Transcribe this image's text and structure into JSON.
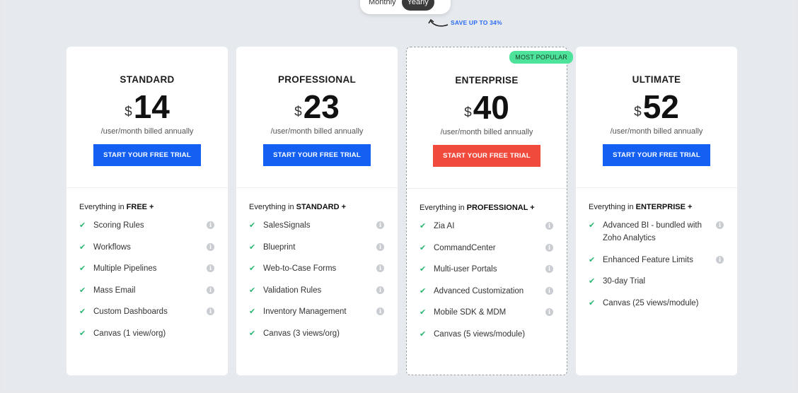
{
  "billing_toggle": {
    "options": [
      "Monthly",
      "Yearly"
    ],
    "selected": "Yearly"
  },
  "save_note": "SAVE UP TO 34%",
  "colors": {
    "primary_cta": "#1460f2",
    "featured_cta": "#ef4a3c",
    "badge": "#4ee39a",
    "check": "#2bb673"
  },
  "plans": [
    {
      "name": "STANDARD",
      "currency": "$",
      "price": "14",
      "period": "/user/month billed annually",
      "cta": "START YOUR FREE TRIAL",
      "everything_prefix": "Everything in ",
      "everything_plan": "FREE +",
      "features": [
        {
          "label": "Scoring Rules",
          "info": true
        },
        {
          "label": "Workflows",
          "info": true
        },
        {
          "label": "Multiple Pipelines",
          "info": true
        },
        {
          "label": "Mass Email",
          "info": true
        },
        {
          "label": "Custom Dashboards",
          "info": true
        },
        {
          "label": "Canvas (1 view/org)",
          "info": false
        }
      ]
    },
    {
      "name": "PROFESSIONAL",
      "currency": "$",
      "price": "23",
      "period": "/user/month billed annually",
      "cta": "START YOUR FREE TRIAL",
      "everything_prefix": "Everything in ",
      "everything_plan": "STANDARD +",
      "features": [
        {
          "label": "SalesSignals",
          "info": true
        },
        {
          "label": "Blueprint",
          "info": true
        },
        {
          "label": "Web-to-Case Forms",
          "info": true
        },
        {
          "label": "Validation Rules",
          "info": true
        },
        {
          "label": "Inventory Management",
          "info": true
        },
        {
          "label": "Canvas (3 views/org)",
          "info": false
        }
      ]
    },
    {
      "name": "ENTERPRISE",
      "badge": "MOST POPULAR",
      "currency": "$",
      "price": "40",
      "period": "/user/month billed annually",
      "cta": "START YOUR FREE TRIAL",
      "everything_prefix": "Everything in ",
      "everything_plan": "PROFESSIONAL +",
      "features": [
        {
          "label": "Zia AI",
          "info": true
        },
        {
          "label": "CommandCenter",
          "info": true
        },
        {
          "label": "Multi-user Portals",
          "info": true
        },
        {
          "label": "Advanced Customization",
          "info": true
        },
        {
          "label": "Mobile SDK & MDM",
          "info": true
        },
        {
          "label": "Canvas (5 views/module)",
          "info": false
        }
      ]
    },
    {
      "name": "ULTIMATE",
      "currency": "$",
      "price": "52",
      "period": "/user/month billed annually",
      "cta": "START YOUR FREE TRIAL",
      "everything_prefix": "Everything in ",
      "everything_plan": "ENTERPRISE +",
      "features": [
        {
          "label": "Advanced BI - bundled with Zoho Analytics",
          "info": true
        },
        {
          "label": "Enhanced Feature Limits",
          "info": true
        },
        {
          "label": "30-day Trial",
          "info": false
        },
        {
          "label": "Canvas (25 views/module)",
          "info": false
        }
      ]
    }
  ]
}
